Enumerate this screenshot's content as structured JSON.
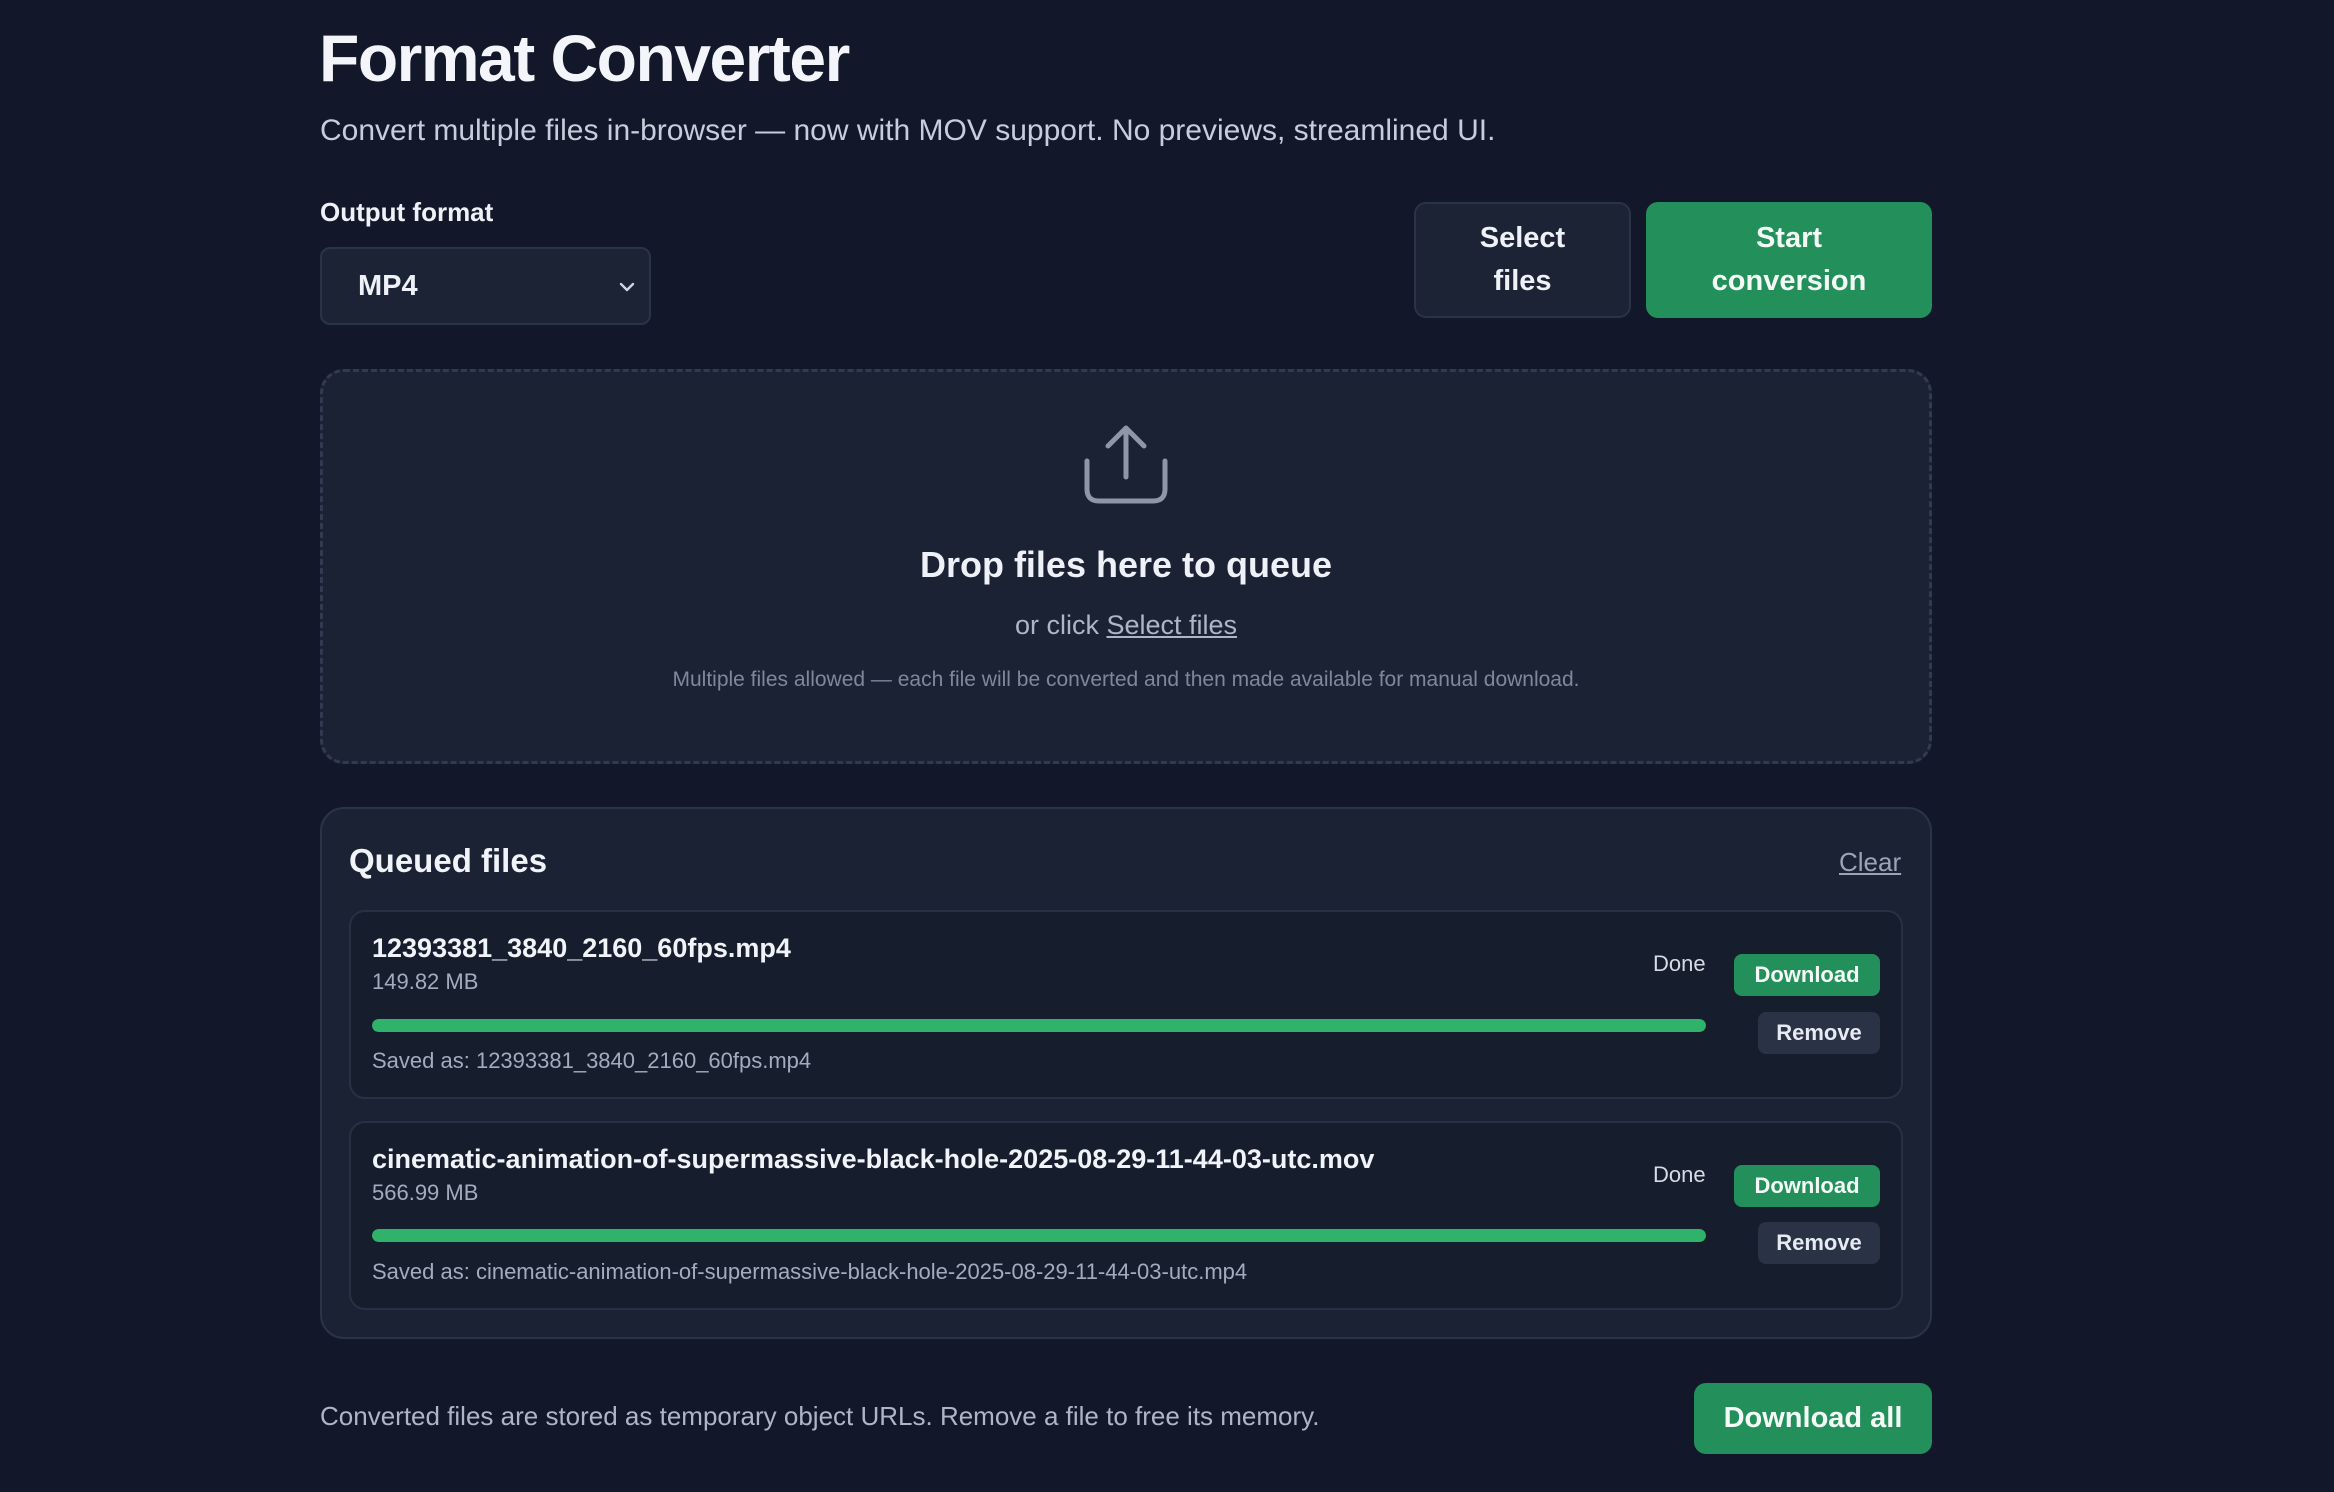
{
  "header": {
    "title": "Format Converter",
    "subtitle": "Convert multiple files in-browser — now with MOV support. No previews, streamlined UI."
  },
  "controls": {
    "output_format_label": "Output format",
    "output_format_value": "MP4",
    "select_files_label": "Select files",
    "start_conversion_label": "Start conversion"
  },
  "dropzone": {
    "icon": "upload-icon",
    "title": "Drop files here to queue",
    "or_click": "or click",
    "select_link": "Select files",
    "hint": "Multiple files allowed — each file will be converted and then made available for manual download."
  },
  "queue": {
    "title": "Queued files",
    "clear_label": "Clear",
    "files": [
      {
        "name": "12393381_3840_2160_60fps.mp4",
        "size": "149.82 MB",
        "status": "Done",
        "progress": 1.0,
        "saved_as": "Saved as: 12393381_3840_2160_60fps.mp4",
        "download_label": "Download",
        "remove_label": "Remove"
      },
      {
        "name": "cinematic-animation-of-supermassive-black-hole-2025-08-29-11-44-03-utc.mov",
        "size": "566.99 MB",
        "status": "Done",
        "progress": 1.0,
        "saved_as": "Saved as: cinematic-animation-of-supermassive-black-hole-2025-08-29-11-44-03-utc.mp4",
        "download_label": "Download",
        "remove_label": "Remove"
      }
    ]
  },
  "footer": {
    "note": "Converted files are stored as temporary object URLs. Remove a file to free its memory.",
    "download_all_label": "Download all"
  },
  "colors": {
    "background": "#121829",
    "accent": "#23905b",
    "progress": "#2fb26a"
  }
}
